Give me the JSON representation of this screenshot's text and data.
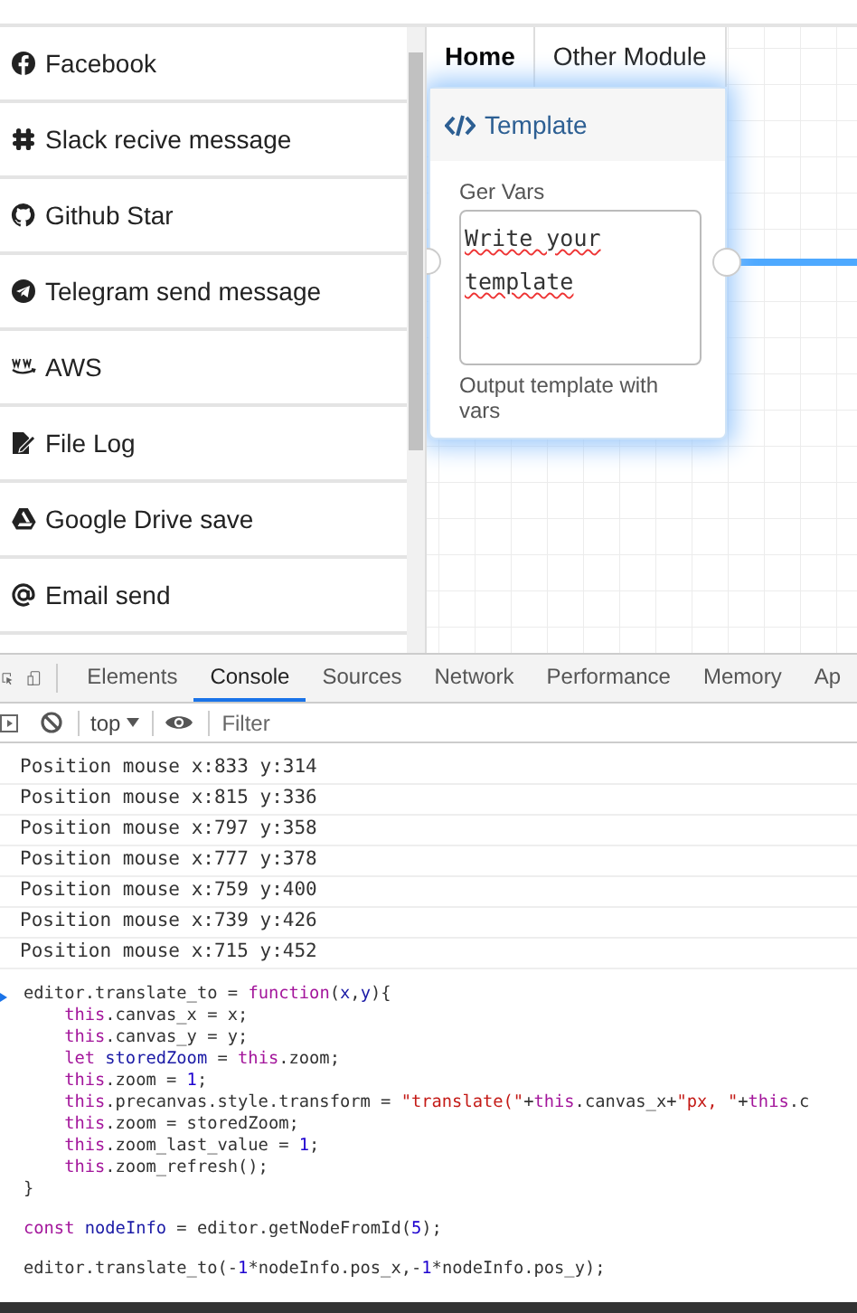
{
  "sidebar": {
    "items": [
      {
        "kind": "facebook",
        "label": "Facebook"
      },
      {
        "kind": "slack",
        "label": "Slack recive message"
      },
      {
        "kind": "github",
        "label": "Github Star"
      },
      {
        "kind": "telegram",
        "label": "Telegram send message"
      },
      {
        "kind": "aws",
        "label": "AWS"
      },
      {
        "kind": "file",
        "label": "File Log"
      },
      {
        "kind": "drive",
        "label": "Google Drive save"
      },
      {
        "kind": "email",
        "label": "Email send"
      }
    ]
  },
  "module_tabs": [
    {
      "label": "Home",
      "selected": true
    },
    {
      "label": "Other Module",
      "selected": false
    }
  ],
  "node": {
    "title": "Template",
    "field_label": "Ger Vars",
    "value": "Write your template",
    "note": "Output template with vars"
  },
  "devtools": {
    "tabs": [
      {
        "label": "Elements",
        "selected": false
      },
      {
        "label": "Console",
        "selected": true
      },
      {
        "label": "Sources",
        "selected": false
      },
      {
        "label": "Network",
        "selected": false
      },
      {
        "label": "Performance",
        "selected": false
      },
      {
        "label": "Memory",
        "selected": false
      },
      {
        "label": "Ap",
        "selected": false
      }
    ],
    "context": "top",
    "filter_placeholder": "Filter",
    "logs": [
      "Position mouse x:833 y:314",
      "Position mouse x:815 y:336",
      "Position mouse x:797 y:358",
      "Position mouse x:777 y:378",
      "Position mouse x:759 y:400",
      "Position mouse x:739 y:426",
      "Position mouse x:715 y:452"
    ],
    "code_blocks": [
      [
        {
          "indented": false,
          "tokens": [
            {
              "kind": "plain",
              "text": "editor.translate_to = "
            },
            {
              "kind": "keyword",
              "text": "function"
            },
            {
              "kind": "plain",
              "text": "("
            },
            {
              "kind": "var",
              "text": "x"
            },
            {
              "kind": "plain",
              "text": ","
            },
            {
              "kind": "var",
              "text": "y"
            },
            {
              "kind": "plain",
              "text": "){"
            }
          ]
        },
        {
          "indented": true,
          "tokens": [
            {
              "kind": "keyword",
              "text": "this"
            },
            {
              "kind": "plain",
              "text": ".canvas_x = x;"
            }
          ]
        },
        {
          "indented": true,
          "tokens": [
            {
              "kind": "keyword",
              "text": "this"
            },
            {
              "kind": "plain",
              "text": ".canvas_y = y;"
            }
          ]
        },
        {
          "indented": true,
          "tokens": [
            {
              "kind": "keyword",
              "text": "let "
            },
            {
              "kind": "var",
              "text": "storedZoom"
            },
            {
              "kind": "plain",
              "text": " = "
            },
            {
              "kind": "keyword",
              "text": "this"
            },
            {
              "kind": "plain",
              "text": ".zoom;"
            }
          ]
        },
        {
          "indented": true,
          "tokens": [
            {
              "kind": "keyword",
              "text": "this"
            },
            {
              "kind": "plain",
              "text": ".zoom = "
            },
            {
              "kind": "number",
              "text": "1"
            },
            {
              "kind": "plain",
              "text": ";"
            }
          ]
        },
        {
          "indented": true,
          "tokens": [
            {
              "kind": "keyword",
              "text": "this"
            },
            {
              "kind": "plain",
              "text": ".precanvas.style.transform = "
            },
            {
              "kind": "string",
              "text": "\"translate(\""
            },
            {
              "kind": "plain",
              "text": "+"
            },
            {
              "kind": "keyword",
              "text": "this"
            },
            {
              "kind": "plain",
              "text": ".canvas_x+"
            },
            {
              "kind": "string",
              "text": "\"px, \""
            },
            {
              "kind": "plain",
              "text": "+"
            },
            {
              "kind": "keyword",
              "text": "this"
            },
            {
              "kind": "plain",
              "text": ".c"
            }
          ]
        },
        {
          "indented": true,
          "tokens": [
            {
              "kind": "keyword",
              "text": "this"
            },
            {
              "kind": "plain",
              "text": ".zoom = storedZoom;"
            }
          ]
        },
        {
          "indented": true,
          "tokens": [
            {
              "kind": "keyword",
              "text": "this"
            },
            {
              "kind": "plain",
              "text": ".zoom_last_value = "
            },
            {
              "kind": "number",
              "text": "1"
            },
            {
              "kind": "plain",
              "text": ";"
            }
          ]
        },
        {
          "indented": true,
          "tokens": [
            {
              "kind": "keyword",
              "text": "this"
            },
            {
              "kind": "plain",
              "text": ".zoom_refresh();"
            }
          ]
        },
        {
          "indented": false,
          "tokens": [
            {
              "kind": "plain",
              "text": "}"
            }
          ]
        }
      ],
      [
        {
          "indented": false,
          "tokens": [
            {
              "kind": "keyword",
              "text": "const "
            },
            {
              "kind": "var",
              "text": "nodeInfo"
            },
            {
              "kind": "plain",
              "text": " = editor.getNodeFromId("
            },
            {
              "kind": "number",
              "text": "5"
            },
            {
              "kind": "plain",
              "text": ");"
            }
          ]
        }
      ],
      [
        {
          "indented": false,
          "tokens": [
            {
              "kind": "plain",
              "text": "editor.translate_to(-"
            },
            {
              "kind": "number",
              "text": "1"
            },
            {
              "kind": "plain",
              "text": "*nodeInfo.pos_x,-"
            },
            {
              "kind": "number",
              "text": "1"
            },
            {
              "kind": "plain",
              "text": "*nodeInfo.pos_y);"
            }
          ]
        }
      ]
    ]
  }
}
